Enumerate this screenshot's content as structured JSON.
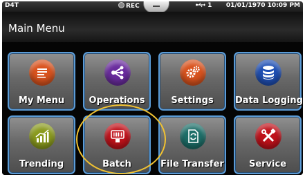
{
  "status_bar": {
    "device_id": "D4T",
    "rec_label": "REC",
    "usb_label": "↻ 1",
    "datetime": "01/01/1970 10:09 PM"
  },
  "header": {
    "title": "Main Menu"
  },
  "tiles": [
    {
      "label": "My Menu",
      "icon": "list-icon",
      "color": "#d9531e"
    },
    {
      "label": "Operations",
      "icon": "share-icon",
      "color": "#6a2c9e"
    },
    {
      "label": "Settings",
      "icon": "gears-icon",
      "color": "#d9531e"
    },
    {
      "label": "Data Logging",
      "icon": "database-icon",
      "color": "#1f4fb3"
    },
    {
      "label": "Trending",
      "icon": "bar-chart-icon",
      "color": "#8a9a1e"
    },
    {
      "label": "Batch",
      "icon": "barcode-icon",
      "color": "#c0121b"
    },
    {
      "label": "File Transfer",
      "icon": "file-transfer-icon",
      "color": "#1d6e68"
    },
    {
      "label": "Service",
      "icon": "tools-icon",
      "color": "#c0121b"
    }
  ],
  "highlight": {
    "color": "#f1c232"
  }
}
